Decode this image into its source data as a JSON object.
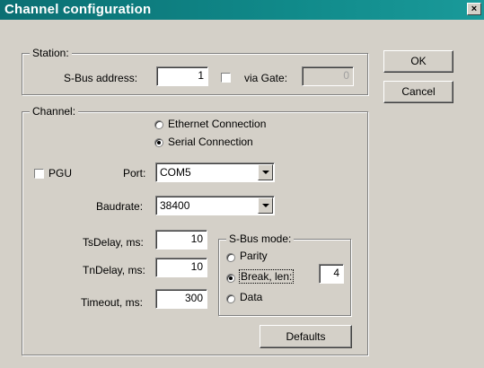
{
  "window": {
    "title": "Channel configuration",
    "close_label": "×"
  },
  "station": {
    "legend": "Station:",
    "sbus_address_label": "S-Bus address:",
    "sbus_address_value": "1",
    "via_gate_label": "via Gate:",
    "via_gate_value": "0"
  },
  "buttons": {
    "ok": "OK",
    "cancel": "Cancel",
    "defaults": "Defaults"
  },
  "channel": {
    "legend": "Channel:",
    "ethernet_label": "Ethernet Connection",
    "serial_label": "Serial Connection",
    "pgu_label": "PGU",
    "port_label": "Port:",
    "port_value": "COM5",
    "baudrate_label": "Baudrate:",
    "baudrate_value": "38400",
    "tsdelay_label": "TsDelay, ms:",
    "tsdelay_value": "10",
    "tndelay_label": "TnDelay, ms:",
    "tndelay_value": "10",
    "timeout_label": "Timeout, ms:",
    "timeout_value": "300"
  },
  "sbus_mode": {
    "legend": "S-Bus mode:",
    "parity_label": "Parity",
    "break_label": "Break, len:",
    "break_len_value": "4",
    "data_label": "Data"
  }
}
